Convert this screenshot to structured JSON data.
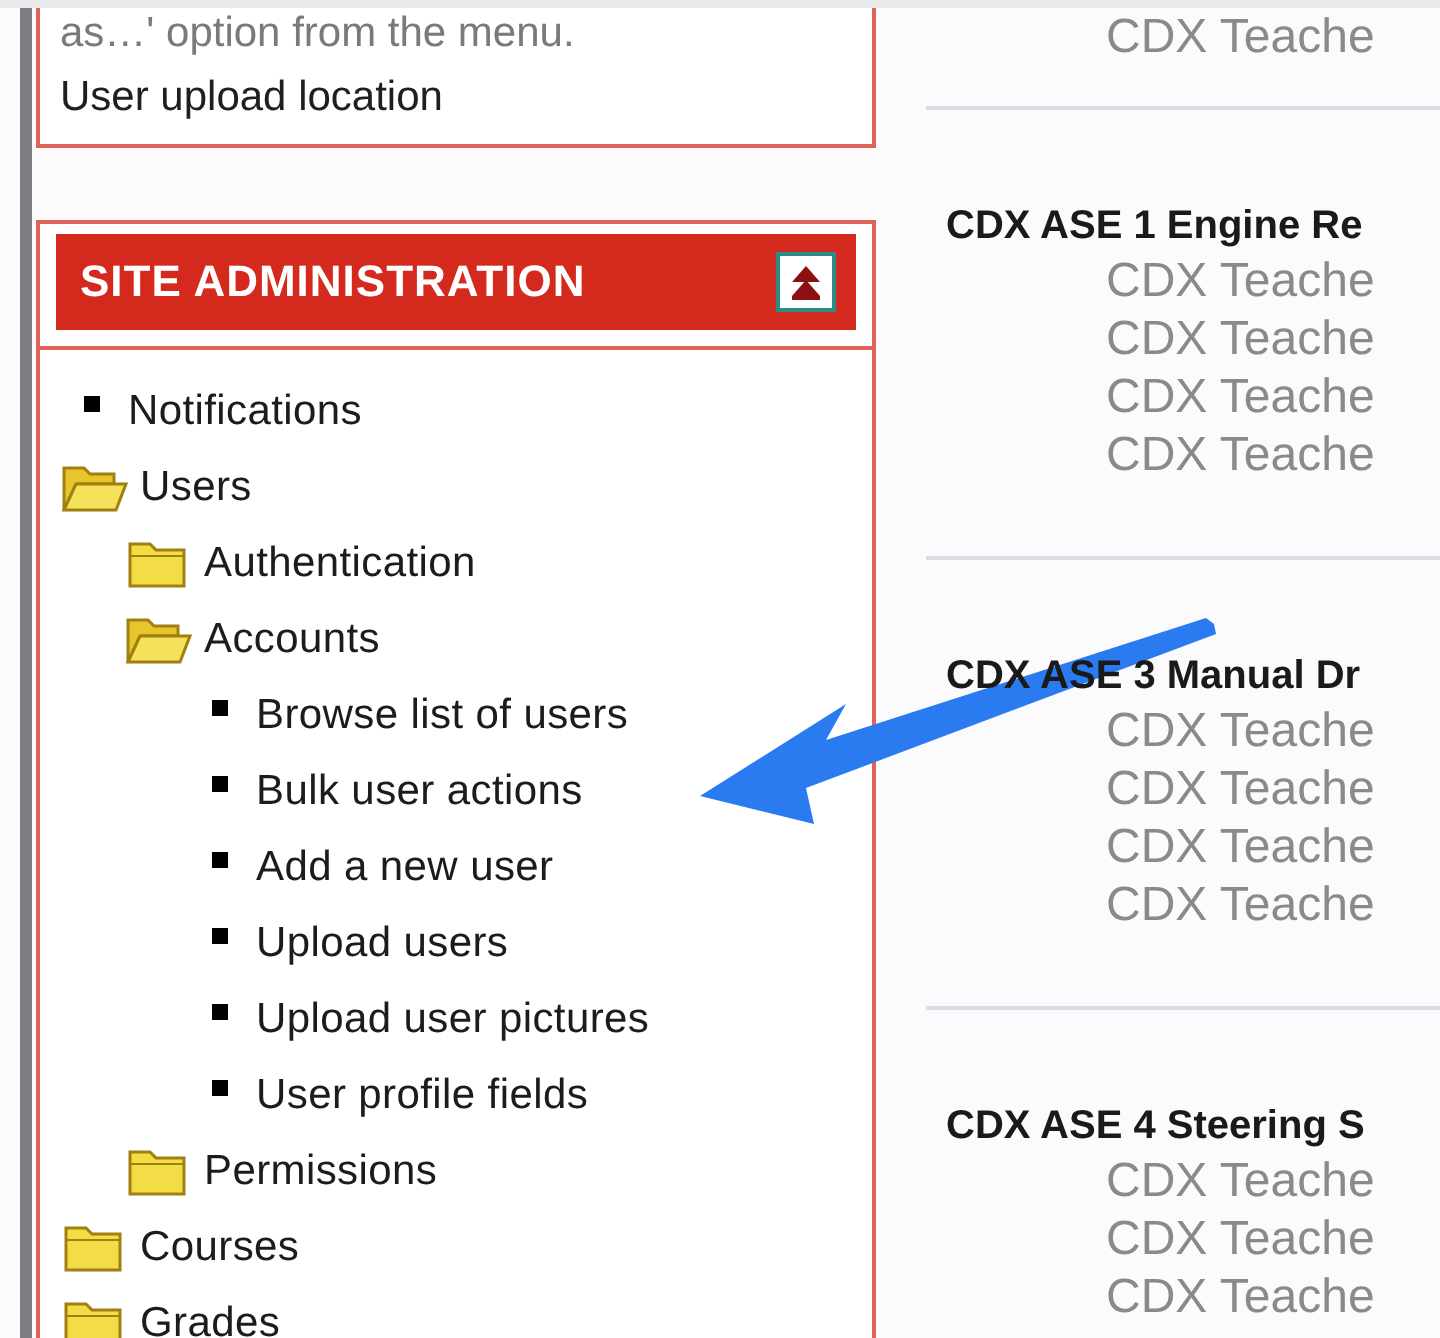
{
  "upload_box": {
    "note": "as…' option from the menu.",
    "link": "User upload location"
  },
  "site_administration": {
    "title": "SITE ADMINISTRATION",
    "tree": [
      {
        "kind": "link",
        "label": "Notifications"
      },
      {
        "kind": "folder",
        "label": "Users",
        "expanded": true,
        "children": [
          {
            "kind": "folder",
            "label": "Authentication",
            "expanded": false
          },
          {
            "kind": "folder",
            "label": "Accounts",
            "expanded": true,
            "children": [
              {
                "kind": "link",
                "label": "Browse list of users"
              },
              {
                "kind": "link",
                "label": "Bulk user actions"
              },
              {
                "kind": "link",
                "label": "Add a new user"
              },
              {
                "kind": "link",
                "label": "Upload users"
              },
              {
                "kind": "link",
                "label": "Upload user pictures"
              },
              {
                "kind": "link",
                "label": "User profile fields"
              }
            ]
          },
          {
            "kind": "folder",
            "label": "Permissions",
            "expanded": false
          }
        ]
      },
      {
        "kind": "folder",
        "label": "Courses",
        "expanded": false
      },
      {
        "kind": "folder",
        "label": "Grades",
        "expanded": false
      }
    ]
  },
  "courses": [
    {
      "teachers": [
        "CDX Teache"
      ]
    },
    {
      "name": "CDX ASE 1 Engine Re",
      "teachers": [
        "CDX Teache",
        "CDX Teache",
        "CDX Teache",
        "CDX Teache"
      ]
    },
    {
      "name": "CDX ASE 3 Manual Dr",
      "teachers": [
        "CDX Teache",
        "CDX Teache",
        "CDX Teache",
        "CDX Teache"
      ]
    },
    {
      "name": "CDX ASE 4 Steering S",
      "teachers": [
        "CDX Teache",
        "CDX Teache",
        "CDX Teache"
      ]
    }
  ]
}
